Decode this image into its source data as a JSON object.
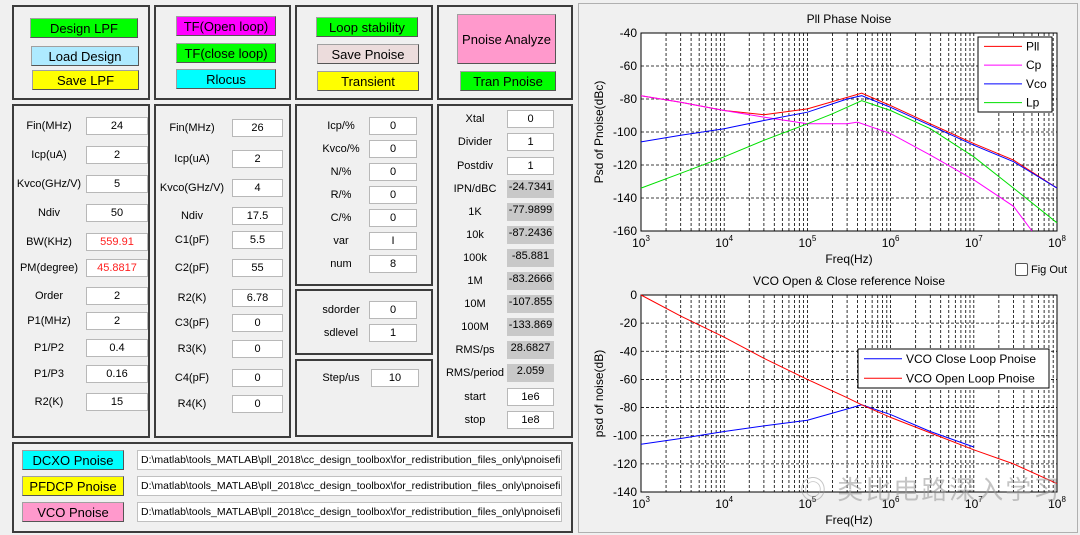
{
  "top_buttons": [
    {
      "label": "Design LPF",
      "color": "#00ff00"
    },
    {
      "label": "Load Design",
      "color": "#aeeaff"
    },
    {
      "label": "Save LPF",
      "color": "#ffff00"
    },
    {
      "label": "TF(Open loop)",
      "color": "#ff00ff"
    },
    {
      "label": "TF(close loop)",
      "color": "#00ff00"
    },
    {
      "label": "Rlocus",
      "color": "#00ffff"
    },
    {
      "label": "Loop stability",
      "color": "#00ff00"
    },
    {
      "label": "Save Pnoise",
      "color": "#ecdcdc"
    },
    {
      "label": "Transient",
      "color": "#ffff00"
    },
    {
      "label": "Pnoise Analyze",
      "color": "#ff99cc"
    },
    {
      "label": "Tran Pnoise",
      "color": "#00ff00"
    }
  ],
  "panel_lpf": [
    {
      "label": "Fin(MHz)",
      "value": "24"
    },
    {
      "label": "Icp(uA)",
      "value": "2"
    },
    {
      "label": "Kvco(GHz/V)",
      "value": "5"
    },
    {
      "label": "Ndiv",
      "value": "50"
    },
    {
      "label": "BW(KHz)",
      "value": "559.91",
      "kind": "err"
    },
    {
      "label": "PM(degree)",
      "value": "45.8817",
      "kind": "err"
    },
    {
      "label": "Order",
      "value": "2"
    },
    {
      "label": "P1(MHz)",
      "value": "2"
    },
    {
      "label": "P1/P2",
      "value": "0.4"
    },
    {
      "label": "P1/P3",
      "value": "0.16"
    },
    {
      "label": "R2(K)",
      "value": "15"
    }
  ],
  "panel_loop": [
    {
      "label": "Fin(MHz)",
      "value": "26"
    },
    {
      "label": "Icp(uA)",
      "value": "2"
    },
    {
      "label": "Kvco(GHz/V)",
      "value": "4"
    },
    {
      "label": "Ndiv",
      "value": "17.5"
    },
    {
      "label": "C1(pF)",
      "value": "5.5"
    },
    {
      "label": "C2(pF)",
      "value": "55"
    },
    {
      "label": "R2(K)",
      "value": "6.78"
    },
    {
      "label": "C3(pF)",
      "value": "0"
    },
    {
      "label": "R3(K)",
      "value": "0"
    },
    {
      "label": "C4(pF)",
      "value": "0"
    },
    {
      "label": "R4(K)",
      "value": "0"
    }
  ],
  "panel_var": [
    {
      "label": "Icp/%",
      "value": "0"
    },
    {
      "label": "Kvco/%",
      "value": "0"
    },
    {
      "label": "N/%",
      "value": "0"
    },
    {
      "label": "R/%",
      "value": "0"
    },
    {
      "label": "C/%",
      "value": "0"
    },
    {
      "label": "var",
      "value": "I"
    },
    {
      "label": "num",
      "value": "8"
    }
  ],
  "panel_sd": [
    {
      "label": "sdorder",
      "value": "0"
    },
    {
      "label": "sdlevel",
      "value": "1"
    }
  ],
  "panel_step": [
    {
      "label": "Step/us",
      "value": "10"
    }
  ],
  "panel_noise": [
    {
      "label": "Xtal",
      "value": "0"
    },
    {
      "label": "Divider",
      "value": "1"
    },
    {
      "label": "Postdiv",
      "value": "1"
    },
    {
      "label": "IPN/dBC",
      "value": "-24.7341",
      "kind": "ro"
    },
    {
      "label": "1K",
      "value": "-77.9899",
      "kind": "ro"
    },
    {
      "label": "10k",
      "value": "-87.2436",
      "kind": "ro"
    },
    {
      "label": "100k",
      "value": "-85.881",
      "kind": "ro"
    },
    {
      "label": "1M",
      "value": "-83.2666",
      "kind": "ro"
    },
    {
      "label": "10M",
      "value": "-107.855",
      "kind": "ro"
    },
    {
      "label": "100M",
      "value": "-133.869",
      "kind": "ro"
    },
    {
      "label": "RMS/ps",
      "value": "28.6827",
      "kind": "ro"
    },
    {
      "label": "RMS/period",
      "value": "2.059",
      "kind": "ro"
    },
    {
      "label": "start",
      "value": "1e6"
    },
    {
      "label": "stop",
      "value": "1e8"
    }
  ],
  "file_rows": [
    {
      "label": "DCXO Pnoise",
      "color": "#00ffff",
      "path": "D:\\matlab\\tools_MATLAB\\pll_2018\\cc_design_toolbox\\for_redistribution_files_only\\pnoisefi"
    },
    {
      "label": "PFDCP Pnoise",
      "color": "#ffff00",
      "path": "D:\\matlab\\tools_MATLAB\\pll_2018\\cc_design_toolbox\\for_redistribution_files_only\\pnoisefi"
    },
    {
      "label": "VCO Pnoise",
      "color": "#ff99cc",
      "path": "D:\\matlab\\tools_MATLAB\\pll_2018\\cc_design_toolbox\\for_redistribution_files_only\\pnoisefi"
    }
  ],
  "fig_out_label": "Fig Out",
  "watermark": "类比电路深入学习",
  "chart_data": [
    {
      "type": "line",
      "title": "Pll Phase Noise",
      "xlabel": "Freq(Hz)",
      "ylabel": "Psd of Pnoise(dBc)",
      "xscale": "log",
      "xlim": [
        1000,
        100000000
      ],
      "ylim": [
        -160,
        -40
      ],
      "yticks": [
        -40,
        -60,
        -80,
        -100,
        -120,
        -140,
        -160
      ],
      "xticks": [
        "10^3",
        "10^4",
        "10^5",
        "10^6",
        "10^7",
        "10^8"
      ],
      "grid": true,
      "legend": "top-right",
      "series": [
        {
          "name": "Pll",
          "color": "#ff0000",
          "x": [
            1000.0,
            3000.0,
            10000.0,
            30000.0,
            100000.0,
            300000.0,
            450000.0,
            1000000.0,
            3000000.0,
            10000000.0,
            30000000.0,
            100000000.0
          ],
          "y": [
            -78,
            -82,
            -87,
            -89.5,
            -86,
            -79,
            -76.5,
            -84,
            -95,
            -107,
            -117,
            -134
          ]
        },
        {
          "name": "Cp",
          "color": "#ff00ff",
          "x": [
            1000.0,
            3000.0,
            10000.0,
            30000.0,
            100000.0,
            300000.0,
            400000.0,
            1000000.0,
            3000000.0,
            10000000.0,
            30000000.0,
            50000000.0
          ],
          "y": [
            -78,
            -82,
            -87,
            -91,
            -95,
            -95,
            -94,
            -101,
            -114,
            -129,
            -145,
            -160
          ]
        },
        {
          "name": "Vco",
          "color": "#0000ff",
          "x": [
            1000.0,
            3000.0,
            10000.0,
            30000.0,
            100000.0,
            300000.0,
            450000.0,
            1000000.0,
            3000000.0,
            10000000.0,
            30000000.0,
            100000000.0
          ],
          "y": [
            -106,
            -102,
            -98,
            -93,
            -88,
            -80,
            -78,
            -85,
            -96,
            -108,
            -118,
            -134
          ]
        },
        {
          "name": "Lp",
          "color": "#00e000",
          "x": [
            1000.0,
            3000.0,
            10000.0,
            30000.0,
            100000.0,
            200000.0,
            450000.0,
            1000000.0,
            3000000.0,
            10000000.0,
            30000000.0,
            100000000.0
          ],
          "y": [
            -134,
            -125,
            -115,
            -105,
            -95,
            -89,
            -81,
            -87,
            -98,
            -115,
            -134,
            -155
          ]
        }
      ]
    },
    {
      "type": "line",
      "title": "VCO Open & Close reference Noise",
      "xlabel": "Freq(Hz)",
      "ylabel": "psd of noise(dB)",
      "xscale": "log",
      "xlim": [
        1000,
        100000000
      ],
      "ylim": [
        -140,
        0
      ],
      "yticks": [
        0,
        -20,
        -40,
        -60,
        -80,
        -100,
        -120,
        -140
      ],
      "xticks": [
        "10^3",
        "10^4",
        "10^5",
        "10^6",
        "10^7",
        "10^8"
      ],
      "grid": true,
      "legend": "center-right",
      "series": [
        {
          "name": "VCO Close Loop Pnoise",
          "color": "#0000ff",
          "x": [
            1000.0,
            3000.0,
            10000.0,
            30000.0,
            100000.0,
            300000.0,
            450000.0,
            1000000.0,
            3000000.0,
            10000000.0
          ],
          "y": [
            -106,
            -102,
            -97,
            -93,
            -89,
            -81,
            -78,
            -85,
            -97,
            -108
          ]
        },
        {
          "name": "VCO Open Loop Pnoise",
          "color": "#ff0000",
          "x": [
            1000.0,
            3000.0,
            10000.0,
            30000.0,
            100000.0,
            300000.0,
            450000.0,
            1000000.0,
            3000000.0,
            10000000.0,
            30000000.0,
            100000000.0
          ],
          "y": [
            0,
            -15,
            -30,
            -45,
            -60,
            -73,
            -78,
            -87,
            -98,
            -110,
            -120,
            -134
          ]
        }
      ]
    }
  ]
}
